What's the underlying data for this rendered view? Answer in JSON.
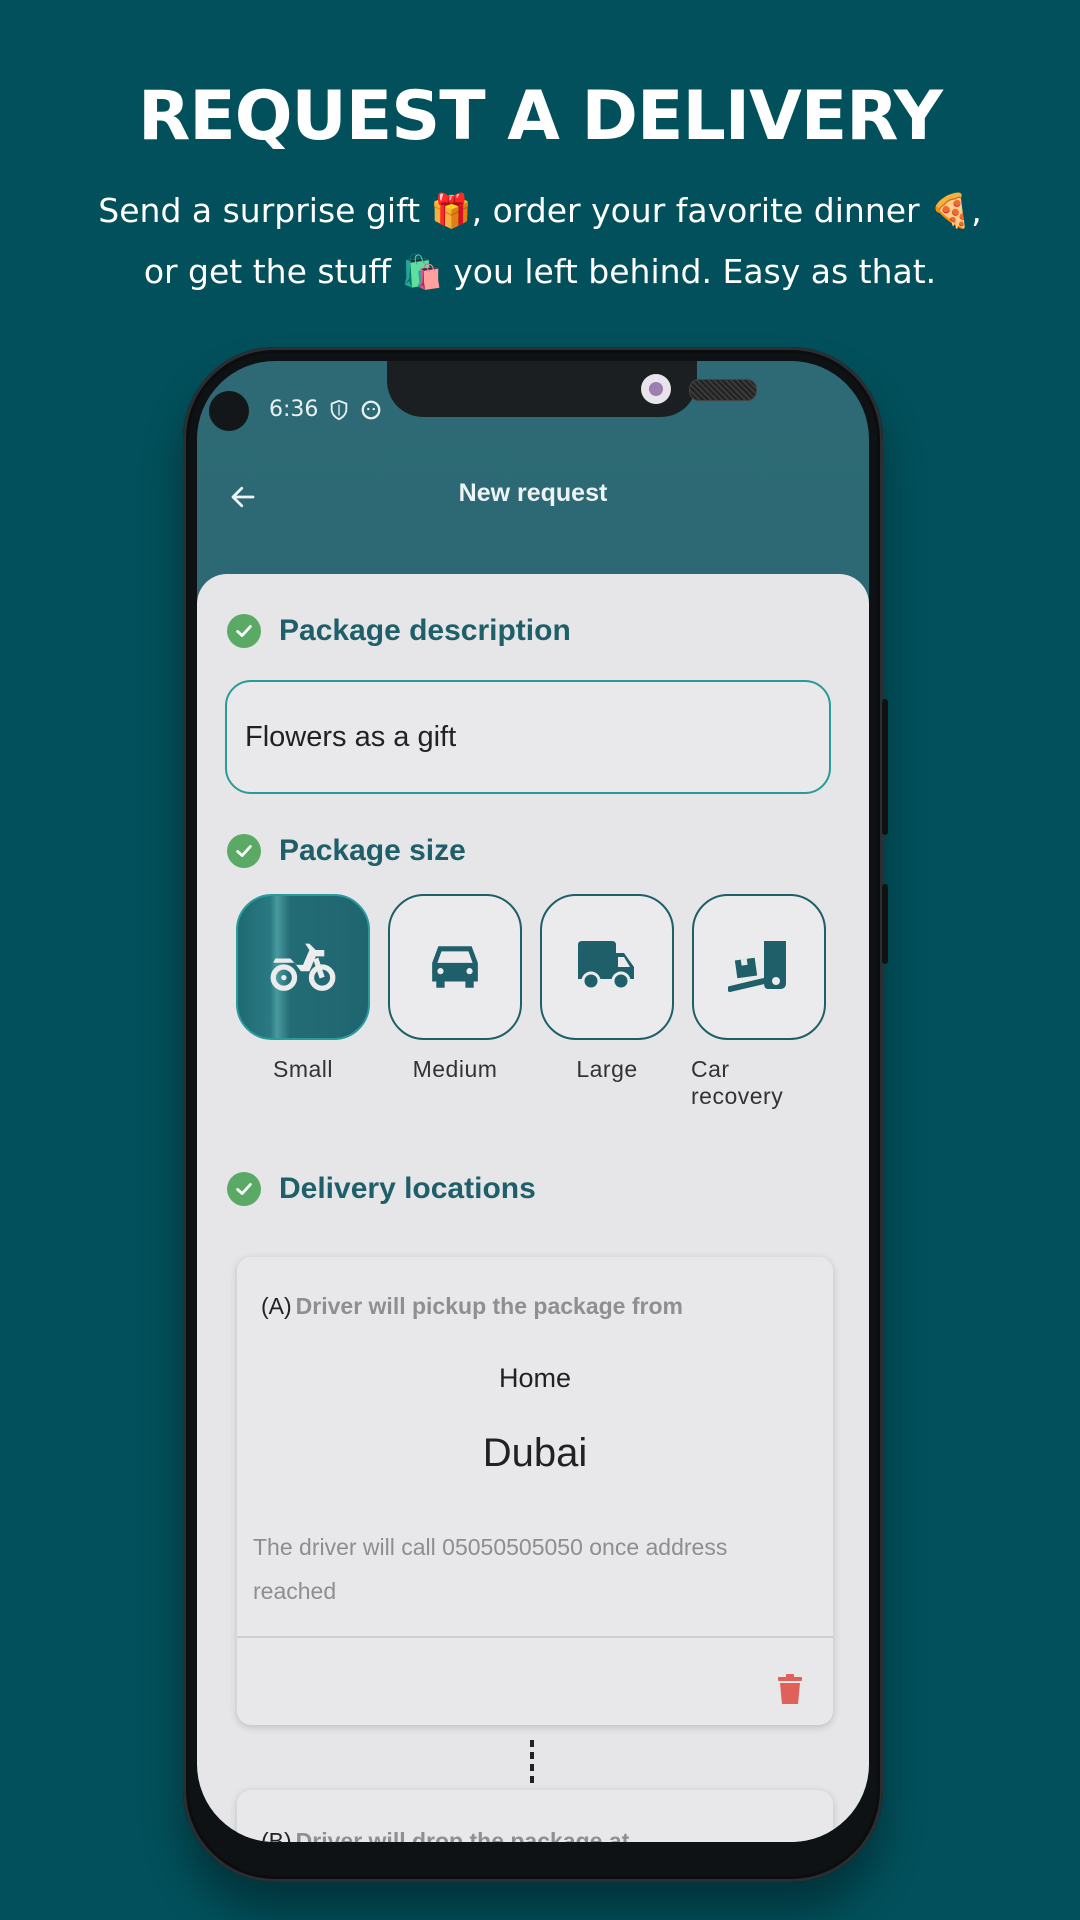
{
  "hero": {
    "title": "REQUEST A DELIVERY",
    "subtitle": "Send a surprise gift 🎁, order your favorite dinner 🍕, or get the stuff 🛍️ you left behind. Easy as that."
  },
  "status_bar": {
    "time": "6:36",
    "icons": [
      "shield-icon",
      "app-notification-icon"
    ]
  },
  "app_bar": {
    "back_icon": "arrow-left-icon",
    "title": "New request"
  },
  "sections": {
    "description": {
      "title": "Package description",
      "value": "Flowers as a gift",
      "completed": true
    },
    "size": {
      "title": "Package size",
      "completed": true,
      "options": [
        {
          "label": "Small",
          "icon": "motorcycle-icon",
          "selected": true
        },
        {
          "label": "Medium",
          "icon": "car-icon",
          "selected": false
        },
        {
          "label": "Large",
          "icon": "truck-icon",
          "selected": false
        },
        {
          "label": "Car recovery",
          "icon": "tow-truck-icon",
          "selected": false
        }
      ]
    },
    "locations": {
      "title": "Delivery locations",
      "completed": true,
      "pickup": {
        "tag": "(A)",
        "lead": "Driver will pickup the package from",
        "name": "Home",
        "city": "Dubai",
        "note": "The driver will call 05050505050 once address reached",
        "delete_icon": "trash-icon"
      },
      "dropoff": {
        "tag": "(B)",
        "lead": "Driver will drop the package at"
      }
    }
  },
  "colors": {
    "background": "#02505b",
    "primary": "#1f5f6a",
    "accent_border": "#2a9b9b",
    "check": "#5aaa65",
    "delete": "#e0605a"
  }
}
